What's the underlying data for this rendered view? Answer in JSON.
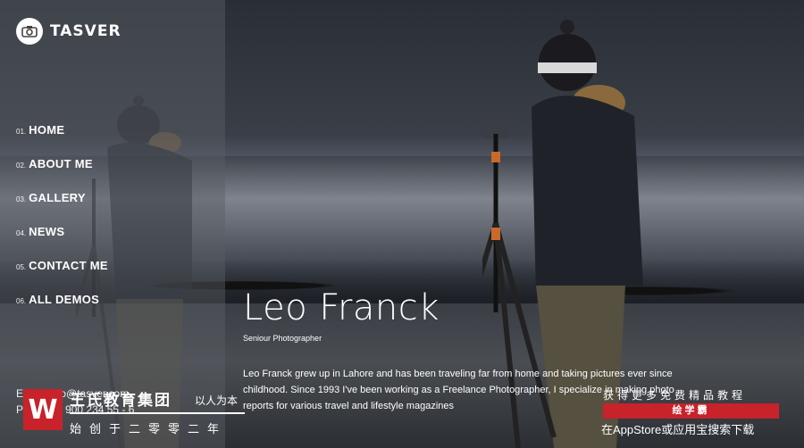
{
  "brand": {
    "name": "TASVER",
    "logo_icon": "camera-icon"
  },
  "menu": [
    {
      "num": "01.",
      "label": "HOME"
    },
    {
      "num": "02.",
      "label": "ABOUT ME"
    },
    {
      "num": "03.",
      "label": "GALLERY"
    },
    {
      "num": "04.",
      "label": "NEWS"
    },
    {
      "num": "05.",
      "label": "CONTACT ME"
    },
    {
      "num": "06.",
      "label": "ALL DEMOS"
    }
  ],
  "contact": {
    "email_line": "Email: info@tasver.com",
    "phone_line": "P: +1 999 900 234 55 - 6"
  },
  "hero": {
    "name": "Leo Franck",
    "role": "Seniour Photographer",
    "bio": "Leo Franck grew up in Lahore and has been traveling far from home and taking pictures ever since childhood. Since 1993 I've been working as a Freelance Photographer, I specialize in making photo reports for various travel and lifestyle magazines"
  },
  "watermark": {
    "logo_letter": "W",
    "name": "王氏教育集团",
    "slogan": "以人为本",
    "since": "始创于二零零二年",
    "right_line1": "获得更多免费精品教程",
    "right_badge": "绘学霸",
    "right_line3": "在AppStore或应用宝搜索下载",
    "accent": "#c8222a"
  }
}
